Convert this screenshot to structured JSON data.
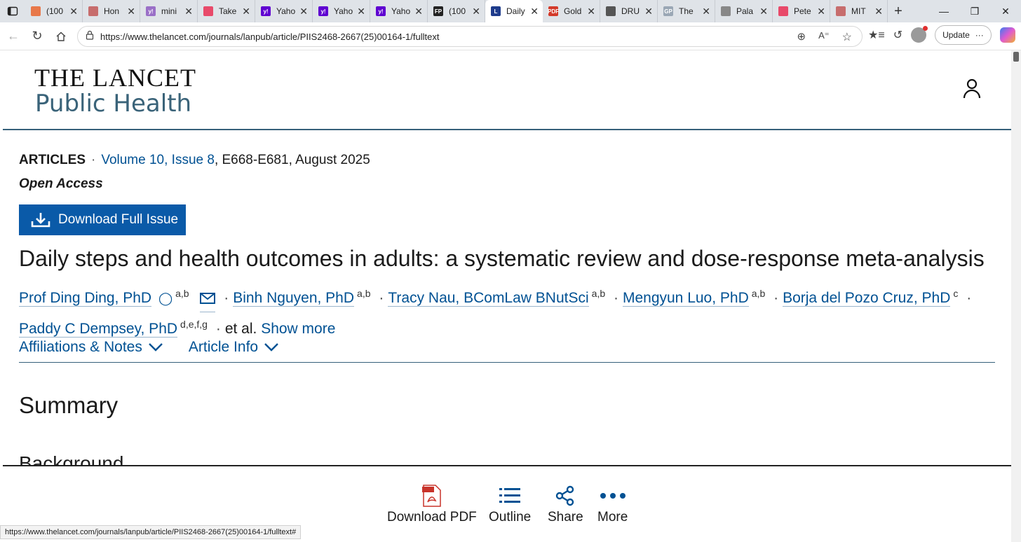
{
  "browser": {
    "tabs": [
      {
        "label": "(100",
        "fav_color": "#e8784a",
        "fav_text": ""
      },
      {
        "label": "Hon",
        "fav_color": "#c76d6d",
        "fav_text": ""
      },
      {
        "label": "mini",
        "fav_color": "#9a6fc7",
        "fav_text": "y!"
      },
      {
        "label": "Take",
        "fav_color": "#e84a6a",
        "fav_text": ""
      },
      {
        "label": "Yaho",
        "fav_color": "#5f01d1",
        "fav_text": "y!"
      },
      {
        "label": "Yaho",
        "fav_color": "#5f01d1",
        "fav_text": "y!"
      },
      {
        "label": "Yaho",
        "fav_color": "#5f01d1",
        "fav_text": "y!"
      },
      {
        "label": "(100",
        "fav_color": "#222222",
        "fav_text": "FP"
      },
      {
        "label": "Daily",
        "fav_color": "#1f3c8c",
        "fav_text": "L",
        "active": true
      },
      {
        "label": "Gold",
        "fav_color": "#d33a2a",
        "fav_text": "PDF"
      },
      {
        "label": "DRU",
        "fav_color": "#555555",
        "fav_text": ""
      },
      {
        "label": "The",
        "fav_color": "#9aa7b5",
        "fav_text": "GP"
      },
      {
        "label": "Pala",
        "fav_color": "#888888",
        "fav_text": ""
      },
      {
        "label": "Pete",
        "fav_color": "#e84a6a",
        "fav_text": ""
      },
      {
        "label": "MIT",
        "fav_color": "#c76d6d",
        "fav_text": ""
      }
    ],
    "url": "https://www.thelancet.com/journals/lanpub/article/PIIS2468-2667(25)00164-1/fulltext",
    "update_label": "Update",
    "status_url": "https://www.thelancet.com/journals/lanpub/article/PIIS2468-2667(25)00164-1/fulltext#"
  },
  "header": {
    "brand_line1": "THE LANCET",
    "brand_line2": "Public Health"
  },
  "article": {
    "type": "ARTICLES",
    "volume": "Volume 10, Issue 8",
    "pages_date": ", E668-E681, August 2025",
    "open_access": "Open Access",
    "download_issue_label": "Download Full Issue",
    "title": "Daily steps and health outcomes in adults: a systematic review and dose-response meta-analysis",
    "authors": [
      {
        "name": "Prof Ding Ding, PhD",
        "sup": "a,b"
      },
      {
        "name": "Binh Nguyen, PhD",
        "sup": "a,b"
      },
      {
        "name": "Tracy Nau, BComLaw BNutSci",
        "sup": "a,b"
      },
      {
        "name": "Mengyun Luo, PhD",
        "sup": "a,b"
      },
      {
        "name": "Borja del Pozo Cruz, PhD",
        "sup": "c"
      },
      {
        "name": "Paddy C Dempsey, PhD",
        "sup": "d,e,f,g"
      }
    ],
    "et_al": "et al.",
    "show_more": "Show more",
    "affiliations_label": "Affiliations & Notes",
    "article_info_label": "Article Info",
    "summary_heading": "Summary",
    "background_heading": "Background"
  },
  "bottom_toolbar": {
    "download_pdf": "Download PDF",
    "outline": "Outline",
    "share": "Share",
    "more": "More"
  }
}
